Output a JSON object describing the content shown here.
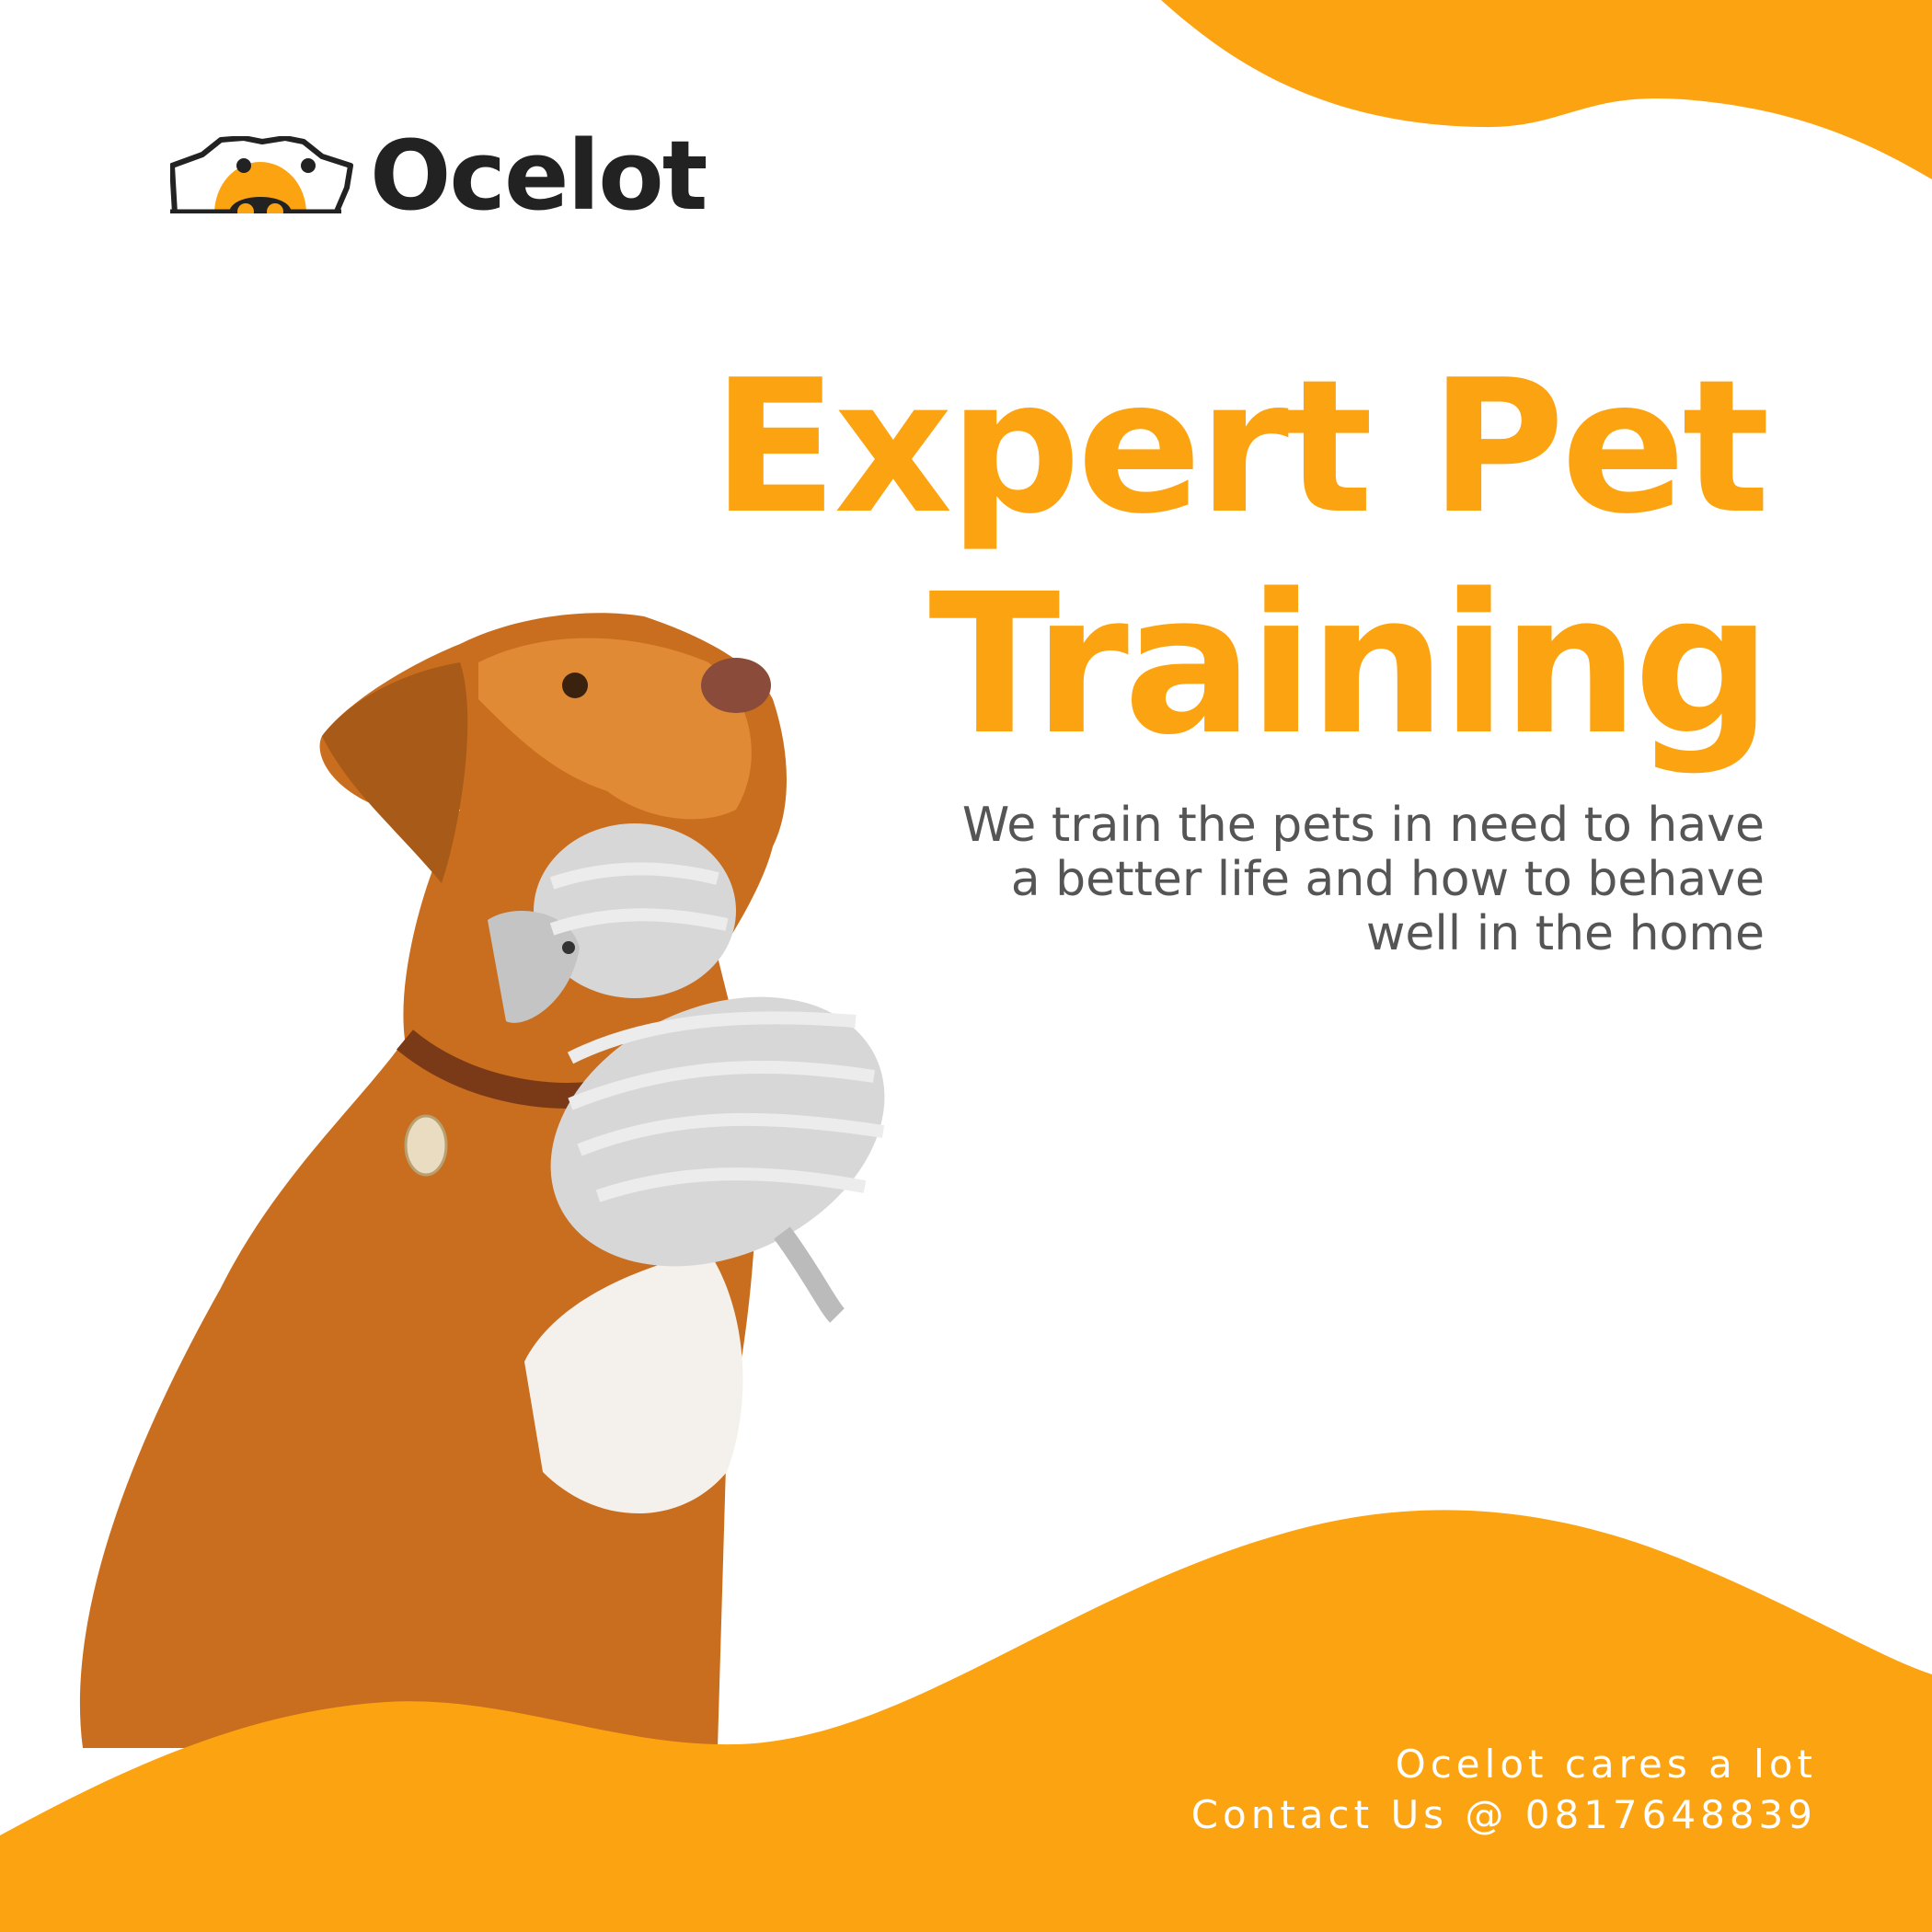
{
  "brand": {
    "name": "Ocelot"
  },
  "headline": {
    "line1": "Expert Pet",
    "line2": "Training"
  },
  "subtitle": {
    "lines": [
      "We train the pets in need to have",
      "a better life and how to behave",
      "well in the home"
    ]
  },
  "footer": {
    "tagline": "Ocelot cares a lot",
    "contact": "Contact Us @ 0817648839"
  },
  "colors": {
    "accent": "#fca311",
    "text": "#555555",
    "logo": "#222222"
  }
}
